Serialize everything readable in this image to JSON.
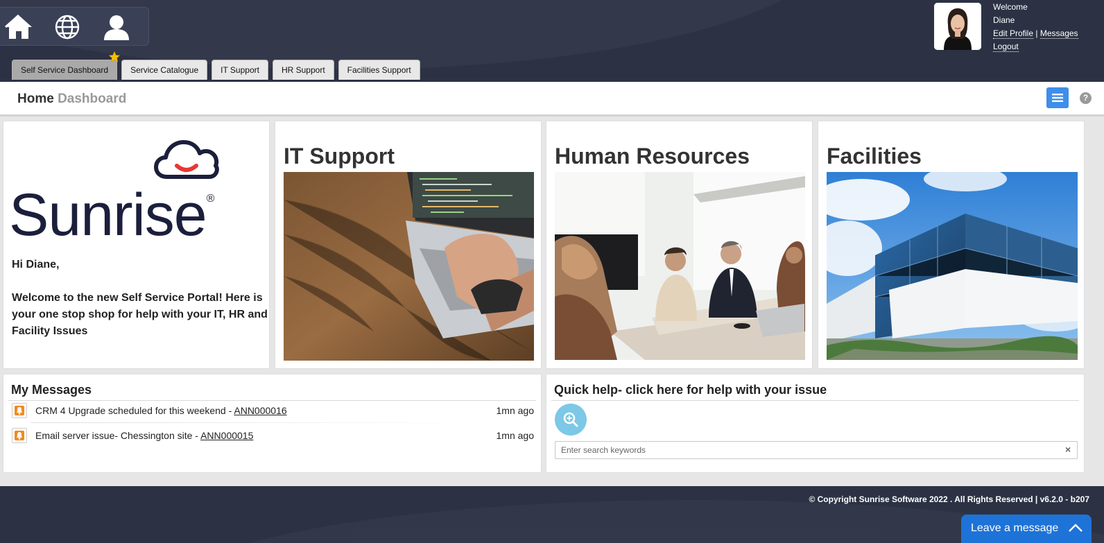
{
  "header": {
    "icons": [
      "home-icon",
      "globe-icon",
      "user-icon"
    ],
    "welcome": {
      "greeting": "Welcome",
      "name": "Diane",
      "edit_profile": "Edit Profile",
      "separator": "|",
      "messages": "Messages",
      "logout": "Logout"
    }
  },
  "tabs": [
    {
      "label": "Self Service Dashboard",
      "active": true
    },
    {
      "label": "Service Catalogue"
    },
    {
      "label": "IT Support"
    },
    {
      "label": "HR Support"
    },
    {
      "label": "Facilities Support"
    }
  ],
  "title_bar": {
    "title": "Home",
    "subtitle": "Dashboard",
    "help_label": "?"
  },
  "welcome_card": {
    "logo_text": "Sunrise",
    "logo_mark": "®",
    "greeting": "Hi Diane,",
    "message": "Welcome to the new Self Service Portal! Here is your one stop shop for help with your IT, HR and Facility Issues"
  },
  "tiles": [
    {
      "title": "IT Support"
    },
    {
      "title": "Human Resources"
    },
    {
      "title": "Facilities"
    }
  ],
  "messages": {
    "title": "My Messages",
    "items": [
      {
        "text": "CRM 4 Upgrade scheduled for this weekend - ",
        "ref": "ANN000016",
        "time": "1mn ago"
      },
      {
        "text": "Email server issue- Chessington site - ",
        "ref": "ANN000015",
        "time": "1mn ago"
      }
    ]
  },
  "quick_help": {
    "title": "Quick help- click here for help with your issue",
    "placeholder": "Enter search keywords",
    "clear": "×"
  },
  "footer": {
    "copyright": "© Copyright Sunrise Software 2022 . All Rights Reserved | v6.2.0 - b207",
    "chat_label": "Leave a message"
  },
  "colors": {
    "header_bg": "#2c3244",
    "accent_blue": "#3e8eea",
    "brand_navy": "#1b1f3b",
    "brand_red": "#e53935",
    "chat_blue": "#1e73d8"
  }
}
